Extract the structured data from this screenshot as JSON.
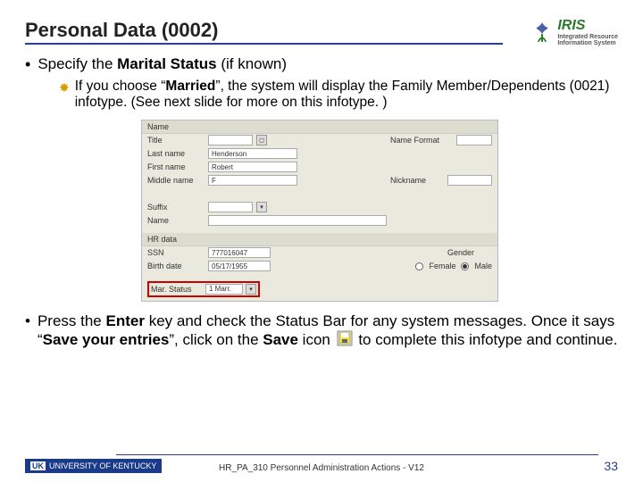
{
  "title": "Personal Data (0002)",
  "logo": {
    "text": "IRIS",
    "sub1": "Integrated Resource",
    "sub2": "Information System"
  },
  "bullet1": {
    "pre": "Specify the ",
    "bold": "Marital Status",
    "post": " (if known)"
  },
  "bullet1a": {
    "pre": "If you choose “",
    "bold": "Married",
    "post": "”, the system will display the Family Member/Dependents (0021) infotype. (See next slide for more on this infotype. )"
  },
  "form": {
    "sec_name": "Name",
    "title_l": "Title",
    "title_btn": "◻",
    "nameformat_l": "Name Format",
    "last_l": "Last name",
    "last_v": "Henderson",
    "first_l": "First name",
    "first_v": "Robert",
    "middle_l": "Middle name",
    "middle_v": "F",
    "nickname_l": "Nickname",
    "suffix_l": "Suffix",
    "name2_l": "Name",
    "sec_hr": "HR data",
    "ssn_l": "SSN",
    "ssn_v": "777016047",
    "gender_l": "Gender",
    "birth_l": "Birth date",
    "birth_v": "05/17/1955",
    "female_l": "Female",
    "male_l": "Male",
    "mar_l": "Mar. Status",
    "mar_v": "1 Marr."
  },
  "bullet2": {
    "t1": "Press the ",
    "b1": "Enter",
    "t2": " key and check the Status Bar for any system messages.  Once it says “",
    "b2": "Save your entries",
    "t3": "”, click on the ",
    "b3": "Save",
    "t4": " icon ",
    "t5": " to complete this infotype and continue."
  },
  "footer": {
    "uk": "UNIVERSITY OF KENTUCKY",
    "center": "HR_PA_310 Personnel Administration Actions - V12",
    "page": "33"
  }
}
